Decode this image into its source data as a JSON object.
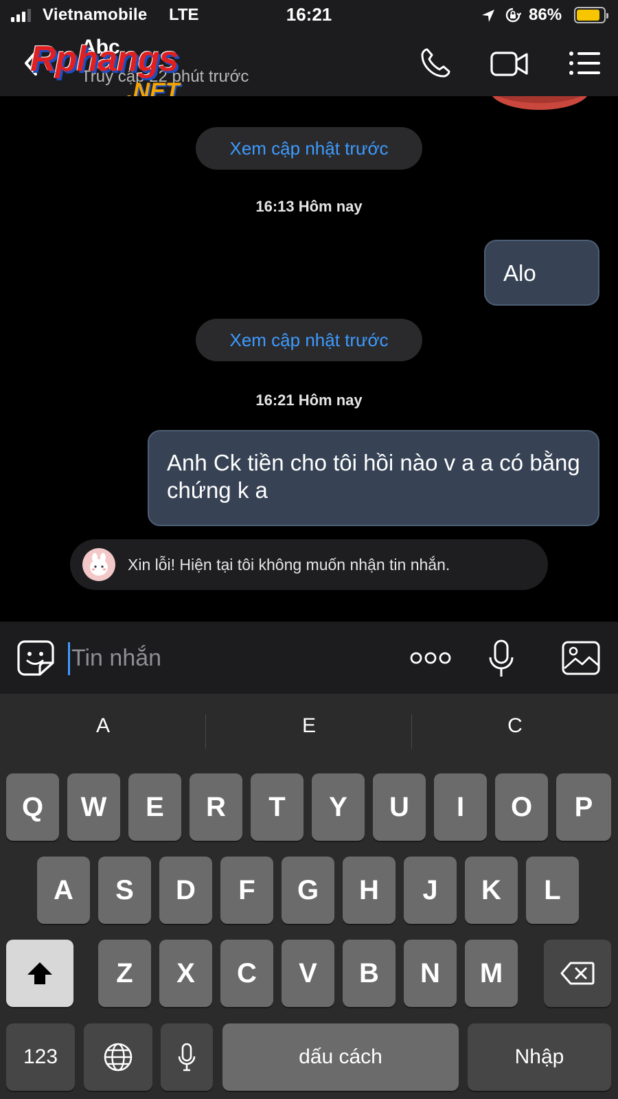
{
  "status_bar": {
    "carrier": "Vietnamobile",
    "network": "LTE",
    "time": "16:21",
    "battery_percent": "86%",
    "battery_level": 0.86,
    "signal_bars": 3,
    "battery_color": "#f7c600"
  },
  "watermark": {
    "main": "Rphangs",
    "sub": ".NET"
  },
  "header": {
    "contact_name": "Abc",
    "last_seen": "Truy cập 22 phút trước",
    "icons": [
      "back-icon",
      "call-icon",
      "video-call-icon",
      "menu-icon"
    ]
  },
  "chat": {
    "view_previous_label": "Xem cập nhật trước",
    "groups": [
      {
        "timestamp": "16:13 Hôm nay",
        "message": "Alo"
      },
      {
        "timestamp": "16:21 Hôm nay",
        "message": "Anh Ck tiền cho tôi hồi nào v a a có bằng chứng k a"
      }
    ],
    "auto_reply": "Xin lỗi! Hiện tại tôi không muốn nhận tin nhắn.",
    "accent_color": "#3e9bff",
    "bubble_color": "#374355"
  },
  "input": {
    "placeholder": "Tin nhắn",
    "value": ""
  },
  "keyboard": {
    "suggestions": [
      "A",
      "E",
      "C"
    ],
    "row1": [
      "Q",
      "W",
      "E",
      "R",
      "T",
      "Y",
      "U",
      "I",
      "O",
      "P"
    ],
    "row2": [
      "A",
      "S",
      "D",
      "F",
      "G",
      "H",
      "J",
      "K",
      "L"
    ],
    "row3": [
      "Z",
      "X",
      "C",
      "V",
      "B",
      "N",
      "M"
    ],
    "numbers_label": "123",
    "space_label": "dấu cách",
    "return_label": "Nhập"
  }
}
